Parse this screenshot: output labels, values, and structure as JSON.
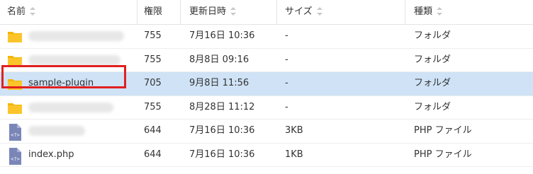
{
  "columns": {
    "name": "名前",
    "permission": "権限",
    "modified": "更新日時",
    "size": "サイズ",
    "type": "種類"
  },
  "rows": [
    {
      "icon": "folder-icon",
      "name": "",
      "name_blurred": true,
      "permission": "755",
      "modified": "7月16日 10:36",
      "size": "-",
      "type": "フォルダ"
    },
    {
      "icon": "folder-icon",
      "name": "",
      "name_blurred": true,
      "permission": "755",
      "modified": "8月8日 09:16",
      "size": "-",
      "type": "フォルダ"
    },
    {
      "icon": "folder-icon",
      "name": "sample-plugin",
      "name_blurred": false,
      "permission": "705",
      "modified": "9月8日 11:56",
      "size": "-",
      "type": "フォルダ",
      "selected": true,
      "highlighted": true
    },
    {
      "icon": "folder-icon",
      "name": "",
      "name_blurred": true,
      "permission": "755",
      "modified": "8月28日 11:12",
      "size": "-",
      "type": "フォルダ"
    },
    {
      "icon": "php-file-icon",
      "name": "",
      "name_blurred": true,
      "permission": "644",
      "modified": "7月16日 10:36",
      "size": "3KB",
      "type": "PHP ファイル"
    },
    {
      "icon": "php-file-icon",
      "name": "index.php",
      "name_blurred": false,
      "permission": "644",
      "modified": "7月16日 10:36",
      "size": "1KB",
      "type": "PHP ファイル"
    }
  ],
  "colors": {
    "selected_row": "#cfe2f6",
    "highlight_border": "#e02020",
    "folder": "#f5b400",
    "php_file": "#7a86b8"
  }
}
